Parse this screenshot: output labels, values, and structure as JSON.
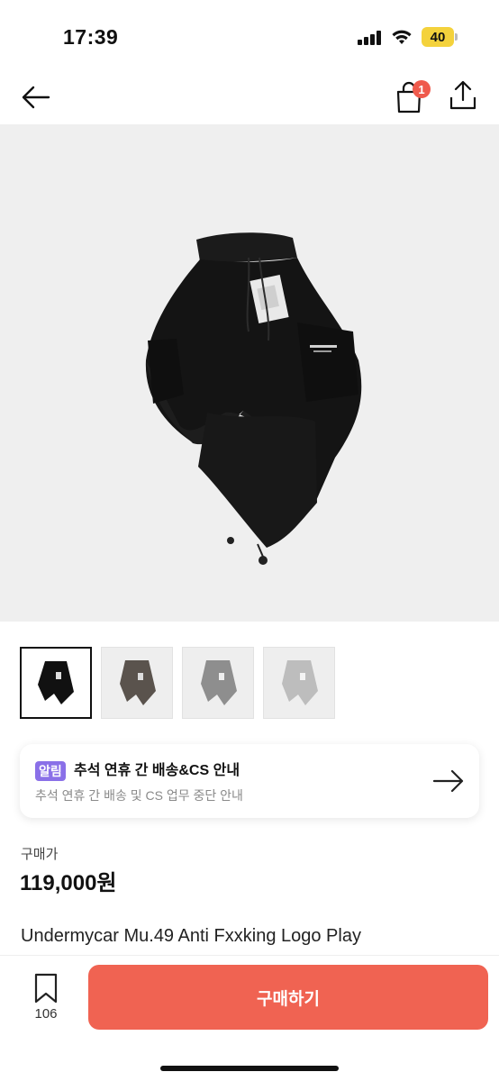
{
  "status_bar": {
    "time": "17:39",
    "battery": "40",
    "icons": [
      "signal-icon",
      "wifi-icon",
      "battery-icon"
    ]
  },
  "nav": {
    "icons": [
      "back-arrow-icon",
      "shopping-bag-icon",
      "share-icon"
    ],
    "cart_badge": "1"
  },
  "gallery": {
    "thumbnails": [
      {
        "name": "black-pants",
        "selected": true
      },
      {
        "name": "brown-pants",
        "selected": false
      },
      {
        "name": "grey-pants",
        "selected": false
      },
      {
        "name": "light-grey-pants",
        "selected": false
      }
    ]
  },
  "notice": {
    "tag": "알림",
    "title": "추석 연휴 간 배송&CS 안내",
    "subtitle": "추석 연휴 간 배송 및 CS 업무 중단 안내",
    "icon": "arrow-right-icon"
  },
  "price": {
    "label": "구매가",
    "value": "119,000원"
  },
  "product": {
    "title": "Undermycar Mu.49 Anti Fxxking Logo Play"
  },
  "bottom_bar": {
    "bookmark_icon": "bookmark-icon",
    "bookmark_count": "106",
    "buy_label": "구매하기"
  },
  "colors": {
    "accent": "#f06352",
    "badge": "#ef5a4c",
    "tag": "#8a70e8",
    "battery": "#f4d23c"
  }
}
